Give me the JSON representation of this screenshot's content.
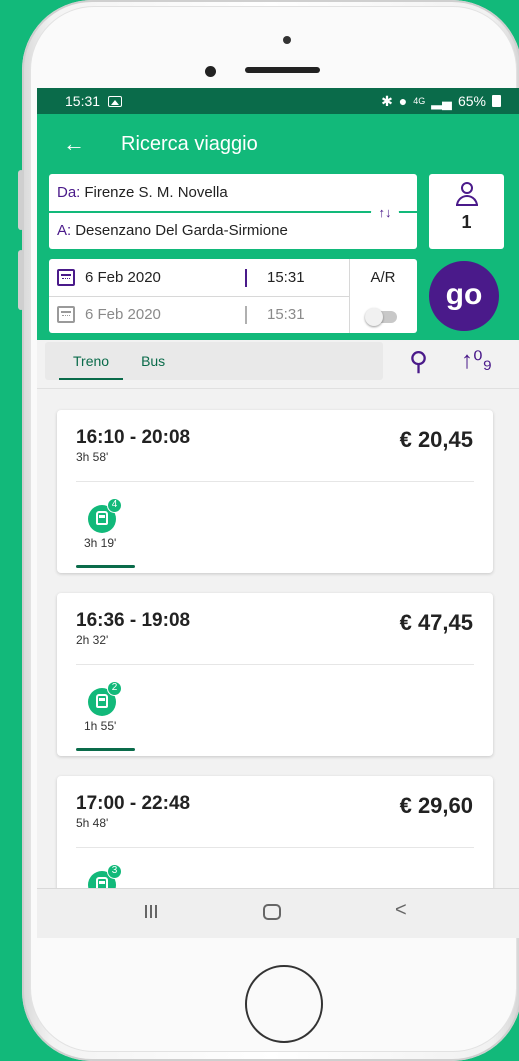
{
  "status": {
    "time": "15:31",
    "right_text": "65%",
    "network": "4G"
  },
  "header": {
    "title": "Ricerca viaggio"
  },
  "route": {
    "from_label": "Da:",
    "from_value": "Firenze S. M. Novella",
    "to_label": "A:",
    "to_value": "Desenzano Del Garda-Sirmione"
  },
  "passengers": {
    "count": "1"
  },
  "dates": {
    "outbound_date": "6 Feb 2020",
    "outbound_time": "15:31",
    "return_date": "6 Feb 2020",
    "return_time": "15:31",
    "ar_label": "A/R"
  },
  "go_button": {
    "label": "go"
  },
  "tabs": [
    {
      "label": "Treno",
      "active": true
    },
    {
      "label": "Bus",
      "active": false
    }
  ],
  "results": [
    {
      "times": "16:10 - 20:08",
      "duration": "3h 58'",
      "price": "€ 20,45",
      "changes": "4",
      "segment_duration": "3h 19'"
    },
    {
      "times": "16:36 - 19:08",
      "duration": "2h 32'",
      "price": "€ 47,45",
      "changes": "2",
      "segment_duration": "1h 55'"
    },
    {
      "times": "17:00 - 22:48",
      "duration": "5h 48'",
      "price": "€ 29,60",
      "changes": "3",
      "segment_duration": ""
    }
  ],
  "colors": {
    "brand_green": "#12b97a",
    "dark_green": "#0a6b4a",
    "purple": "#4a1a8a"
  },
  "icons": [
    "back-arrow-icon",
    "swap-icon",
    "person-icon",
    "calendar-icon",
    "return-calendar-icon",
    "filter-icon",
    "sort-icon",
    "train-icon"
  ]
}
